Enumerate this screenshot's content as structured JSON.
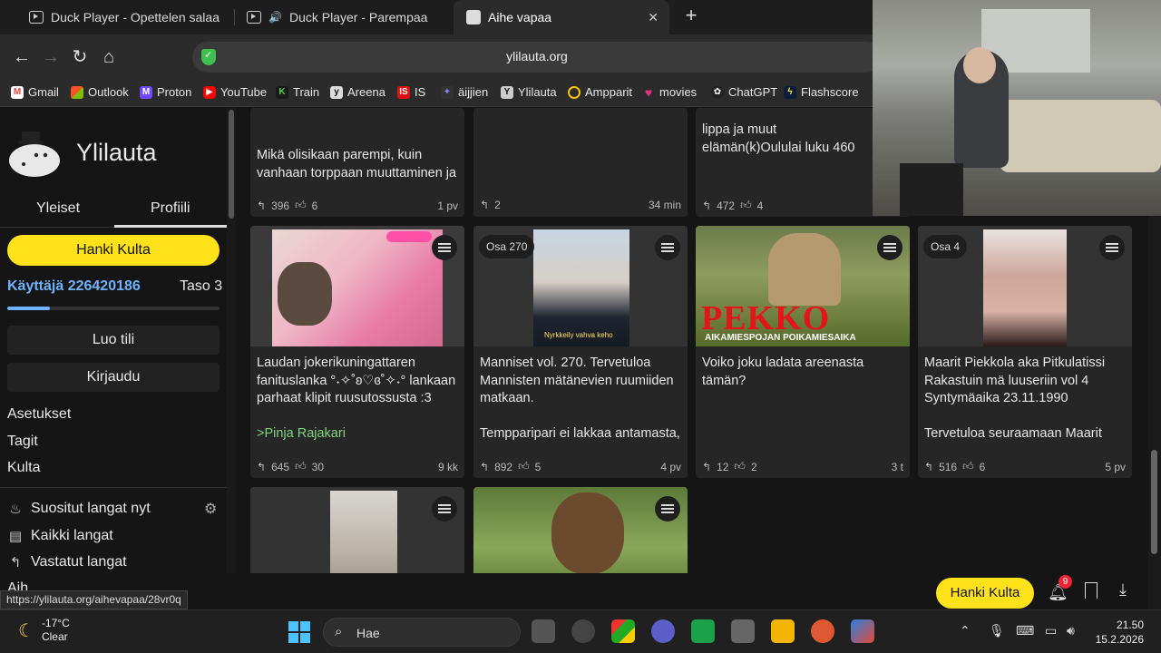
{
  "browser": {
    "tabs": [
      {
        "label": "Duck Player - Opettelen salaa"
      },
      {
        "label": "Duck Player - Parempaa"
      },
      {
        "label": "Aihe vapaa",
        "close": "✕"
      }
    ],
    "new_tab": "+",
    "url": "ylilauta.org",
    "bookmarks": [
      "Gmail",
      "Outlook",
      "Proton",
      "YouTube",
      "Train",
      "Areena",
      "IS",
      "äijjien",
      "Ylilauta",
      "Ampparit",
      "movies",
      "ChatGPT",
      "Flashscore"
    ],
    "status_url": "https://ylilauta.org/aihevapaa/28vr0q"
  },
  "sidebar": {
    "site_title": "Ylilauta",
    "tabs": [
      "Yleiset",
      "Profiili"
    ],
    "gold_button": "Hanki Kulta",
    "user_label": "Käyttäjä 226420186",
    "level_label": "Taso 3",
    "level_progress": 0.2,
    "create_account": "Luo tili",
    "login": "Kirjaudu",
    "links": [
      "Asetukset",
      "Tagit",
      "Kulta"
    ],
    "nav": [
      {
        "label": "Suositut langat nyt",
        "icon": "flame-icon"
      },
      {
        "label": "Kaikki langat",
        "icon": "list-icon"
      },
      {
        "label": "Vastatut langat",
        "icon": "reply-icon"
      }
    ],
    "partial_label": "Aih"
  },
  "feed": {
    "top_cards": [
      {
        "text": "Mikä olisikaan parempi, kuin vanhaan torppaan muuttaminen ja",
        "replies": "396",
        "likes": "6",
        "age": "1 pv"
      },
      {
        "text": "",
        "replies": "2",
        "likes": "",
        "age": "34 min"
      },
      {
        "text": "lippa ja muut elämän(k)Oululai luku 460",
        "replies": "472",
        "likes": "4",
        "age": ""
      }
    ],
    "cards": [
      {
        "osa": "",
        "text": "Laudan jokerikuningattaren fanituslanka °˖✧˚ʚ♡ɞ˚✧˖° lankaan parhaat klipit ruusutossusta :3",
        "quote": ">Pinja Rajakari",
        "replies": "645",
        "likes": "30",
        "age": "9 kk"
      },
      {
        "osa": "Osa 270",
        "text": "Manniset vol. 270. Tervetuloa Mannisten mätänevien ruumiiden matkaan.",
        "quote": "Tempparipari ei lakkaa antamasta,",
        "replies": "892",
        "likes": "5",
        "age": "4 pv",
        "thumb_caption": "Nyrkkeily vahva keho"
      },
      {
        "osa": "",
        "text": "Voiko joku ladata areenasta tämän?",
        "quote": "",
        "replies": "12",
        "likes": "2",
        "age": "3 t",
        "thumb_title": "PEKKO",
        "thumb_subtitle": "AIKAMIESPOJAN POIKAMIESAIKA"
      },
      {
        "osa": "Osa 4",
        "text": "Maarit Piekkola aka Pitkulatissi Rakastuin mä luuseriin vol 4 Syntymäaika 23.11.1990",
        "quote": "Tervetuloa seuraamaan Maarit",
        "replies": "516",
        "likes": "6",
        "age": "5 pv"
      }
    ]
  },
  "bottom": {
    "gold_button": "Hanki Kulta",
    "notifications": "9"
  },
  "taskbar": {
    "temp": "-17°C",
    "condition": "Clear",
    "search": "Hae",
    "time": "21.50",
    "date": "15.2.2026"
  }
}
